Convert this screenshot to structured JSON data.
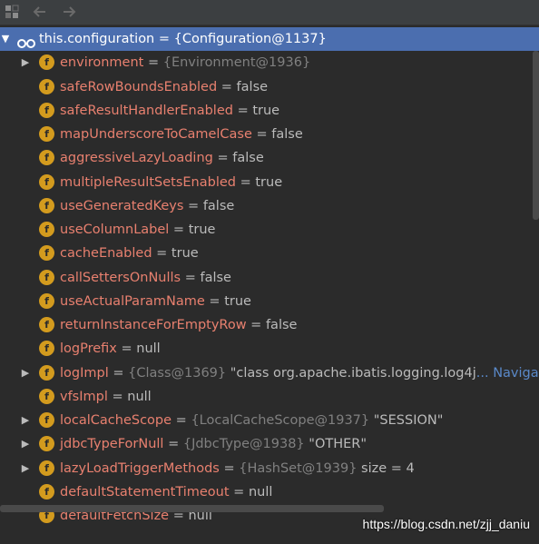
{
  "toolbar": {
    "icons": [
      "restore-layout-icon",
      "back-arrow-icon",
      "forward-arrow-icon"
    ]
  },
  "root": {
    "name": "this.configuration",
    "eq": " = ",
    "value": "{Configuration@1137}",
    "icon": "watch-glasses-icon"
  },
  "fields": [
    {
      "name": "environment",
      "eq": " = ",
      "type": "{Environment@1936}",
      "value": "",
      "nav": "",
      "expandable": true
    },
    {
      "name": "safeRowBoundsEnabled",
      "eq": " = ",
      "type": "",
      "value": "false",
      "nav": "",
      "expandable": false
    },
    {
      "name": "safeResultHandlerEnabled",
      "eq": " = ",
      "type": "",
      "value": "true",
      "nav": "",
      "expandable": false
    },
    {
      "name": "mapUnderscoreToCamelCase",
      "eq": " = ",
      "type": "",
      "value": "false",
      "nav": "",
      "expandable": false
    },
    {
      "name": "aggressiveLazyLoading",
      "eq": " = ",
      "type": "",
      "value": "false",
      "nav": "",
      "expandable": false
    },
    {
      "name": "multipleResultSetsEnabled",
      "eq": " = ",
      "type": "",
      "value": "true",
      "nav": "",
      "expandable": false
    },
    {
      "name": "useGeneratedKeys",
      "eq": " = ",
      "type": "",
      "value": "false",
      "nav": "",
      "expandable": false
    },
    {
      "name": "useColumnLabel",
      "eq": " = ",
      "type": "",
      "value": "true",
      "nav": "",
      "expandable": false
    },
    {
      "name": "cacheEnabled",
      "eq": " = ",
      "type": "",
      "value": "true",
      "nav": "",
      "expandable": false
    },
    {
      "name": "callSettersOnNulls",
      "eq": " = ",
      "type": "",
      "value": "false",
      "nav": "",
      "expandable": false
    },
    {
      "name": "useActualParamName",
      "eq": " = ",
      "type": "",
      "value": "true",
      "nav": "",
      "expandable": false
    },
    {
      "name": "returnInstanceForEmptyRow",
      "eq": " = ",
      "type": "",
      "value": "false",
      "nav": "",
      "expandable": false
    },
    {
      "name": "logPrefix",
      "eq": " = ",
      "type": "",
      "value": "null",
      "nav": "",
      "expandable": false
    },
    {
      "name": "logImpl",
      "eq": " = ",
      "type": "{Class@1369} ",
      "value": "\"class org.apache.ibatis.logging.log4j",
      "nav": "... Navigate",
      "expandable": true
    },
    {
      "name": "vfsImpl",
      "eq": " = ",
      "type": "",
      "value": "null",
      "nav": "",
      "expandable": false
    },
    {
      "name": "localCacheScope",
      "eq": " = ",
      "type": "{LocalCacheScope@1937} ",
      "value": "\"SESSION\"",
      "nav": "",
      "expandable": true
    },
    {
      "name": "jdbcTypeForNull",
      "eq": " = ",
      "type": "{JdbcType@1938} ",
      "value": "\"OTHER\"",
      "nav": "",
      "expandable": true
    },
    {
      "name": "lazyLoadTriggerMethods",
      "eq": " = ",
      "type": "{HashSet@1939} ",
      "value": " size = 4",
      "nav": "",
      "expandable": true
    },
    {
      "name": "defaultStatementTimeout",
      "eq": " = ",
      "type": "",
      "value": "null",
      "nav": "",
      "expandable": false
    },
    {
      "name": "defaultFetchSize",
      "eq": " = ",
      "type": "",
      "value": "null",
      "nav": "",
      "expandable": false
    }
  ],
  "field_badge": "f",
  "watermark": "https://blog.csdn.net/zjj_daniu",
  "colors": {
    "background": "#2b2b2b",
    "selection": "#4b6eaf",
    "field_name": "#e8806f",
    "field_badge": "#d39b1e",
    "type_ref": "#808080",
    "navigate": "#5a89c9"
  }
}
